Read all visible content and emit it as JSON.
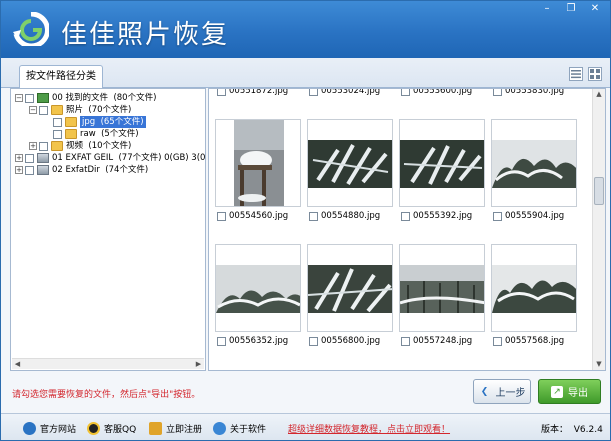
{
  "app": {
    "title": "佳佳照片恢复",
    "window_buttons": {
      "minimize": "–",
      "restore": "❐",
      "close": "✕"
    }
  },
  "tabs": {
    "active_label": "按文件路径分类"
  },
  "tree": {
    "items": [
      {
        "name": "00",
        "label": "找到的文件",
        "count": "(80个文件)"
      },
      {
        "name": "photos",
        "label": "照片",
        "count": "(70个文件)"
      },
      {
        "name": "jpg",
        "label": "jpg",
        "count": "(65个文件)"
      },
      {
        "name": "raw",
        "label": "raw",
        "count": "(5个文件)"
      },
      {
        "name": "video",
        "label": "视频",
        "count": "(10个文件)"
      },
      {
        "name": "01",
        "label": "01 EXFAT GEIL",
        "count": "(77个文件) 0(GB) 3(0"
      },
      {
        "name": "02",
        "label": "02 ExfatDir",
        "count": "(74个文件)"
      }
    ]
  },
  "thumbnails": {
    "top_partial": [
      "00551872.jpg",
      "00553024.jpg",
      "00553600.jpg",
      "00553830.jpg"
    ],
    "row1": [
      {
        "file": "00554560.jpg",
        "scene": "snow-fence"
      },
      {
        "file": "00554880.jpg",
        "scene": "snow-branch"
      },
      {
        "file": "00555392.jpg",
        "scene": "snow-branch"
      },
      {
        "file": "00555904.jpg",
        "scene": "snow-trees"
      }
    ],
    "row2": [
      {
        "file": "00556352.jpg",
        "scene": "snow-trees"
      },
      {
        "file": "00556800.jpg",
        "scene": "snow-branch"
      },
      {
        "file": "00557248.jpg",
        "scene": "snow-trees"
      },
      {
        "file": "00557568.jpg",
        "scene": "snow-trees"
      }
    ]
  },
  "hint": "请勾选您需要恢复的文件，然后点\"导出\"按钮。",
  "buttons": {
    "prev": "上一步",
    "export": "导出"
  },
  "footer": {
    "website": "官方网站",
    "qq": "客服QQ",
    "register": "立即注册",
    "about": "关于软件",
    "tutorial": "超级详细数据恢复教程，点击立即观看！",
    "version_label": "版本：",
    "version": "V6.2.4"
  },
  "colors": {
    "title_bar": "#2a73c3",
    "hint_red": "#d3262d",
    "export_green": "#3f9a2a"
  }
}
